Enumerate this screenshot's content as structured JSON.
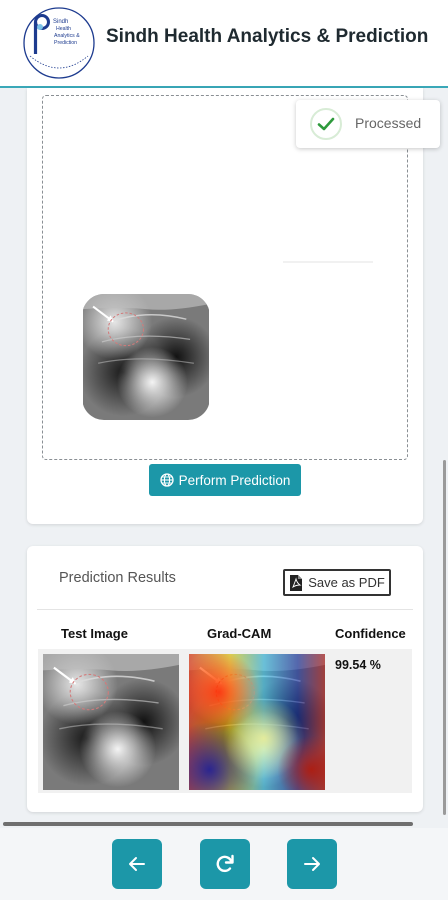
{
  "header": {
    "title": "Sindh Health Analytics & Prediction",
    "logo": {
      "icon": "sindh-health-logo-icon",
      "text_lines": [
        "Sindh",
        "Health",
        "Analytics &",
        "Prediction"
      ]
    }
  },
  "toast": {
    "status": "Processed",
    "icon": "check-icon",
    "color": "#2e9a3c"
  },
  "upload": {
    "perform_button": "Perform Prediction",
    "button_icon": "globe-icon"
  },
  "results": {
    "title": "Prediction Results",
    "save_pdf_label": "Save as PDF",
    "save_pdf_icon": "pdf-file-icon",
    "columns": [
      "Test Image",
      "Grad-CAM",
      "Confidence"
    ],
    "rows": [
      {
        "confidence": "99.54 %"
      }
    ]
  },
  "nav": {
    "back_icon": "arrow-left-icon",
    "refresh_icon": "refresh-icon",
    "forward_icon": "arrow-right-icon"
  },
  "colors": {
    "accent": "#1c97a8",
    "header_border": "#3aa8b8",
    "logo_blue": "#1d3b8f"
  }
}
